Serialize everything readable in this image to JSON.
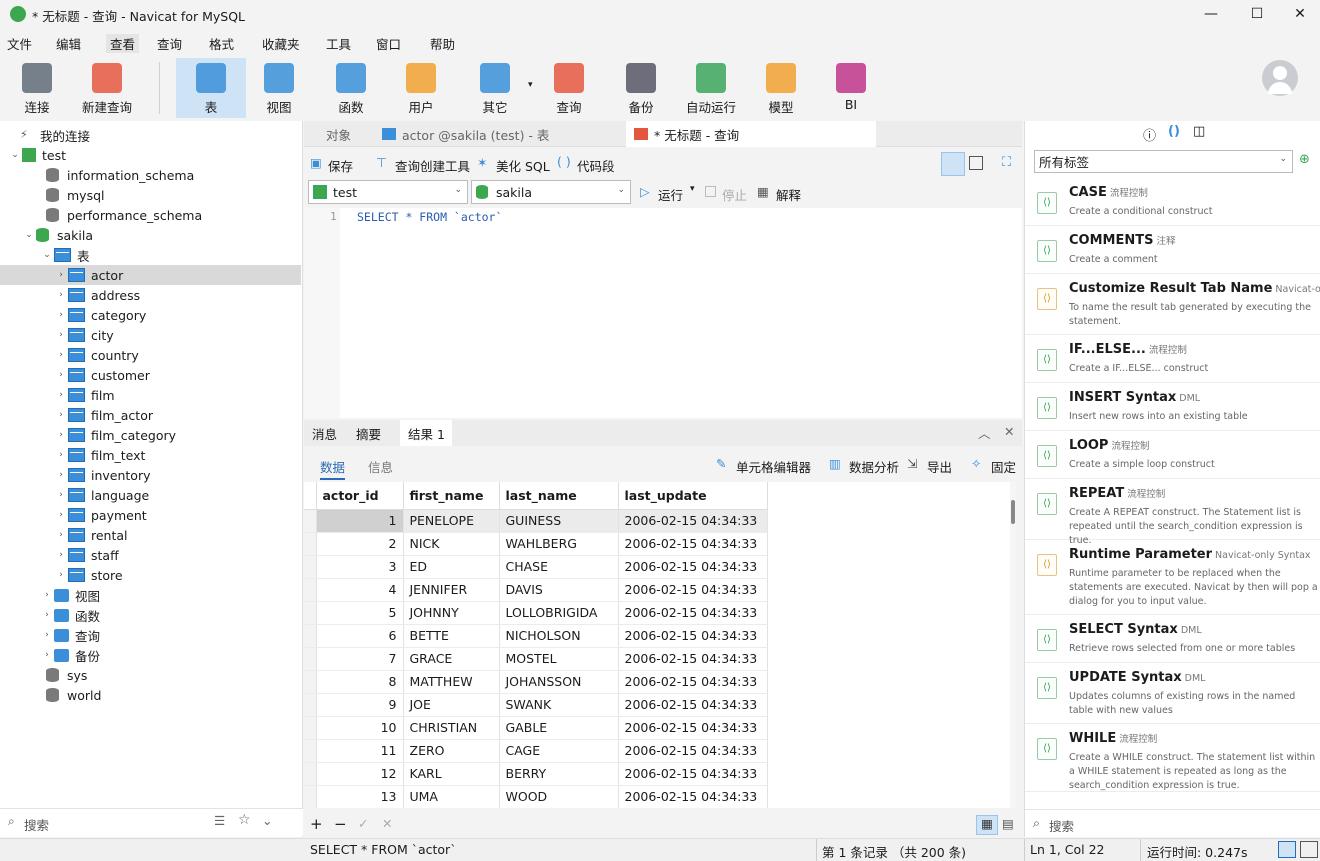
{
  "window": {
    "title": "* 无标题 - 查询 - Navicat for MySQL",
    "min": "—",
    "max": "☐",
    "close": "✕"
  },
  "menu": [
    "文件",
    "编辑",
    "查看",
    "查询",
    "格式",
    "收藏夹",
    "工具",
    "窗口",
    "帮助"
  ],
  "ribbon": [
    {
      "label": "连接",
      "icon": "plug-icon",
      "color": "#5e6b78"
    },
    {
      "label": "新建查询",
      "icon": "new-query-icon",
      "color": "#e4573f"
    },
    {
      "label": "表",
      "icon": "table-icon",
      "color": "#3a8fd8",
      "active": true
    },
    {
      "label": "视图",
      "icon": "view-icon",
      "color": "#3a8fd8"
    },
    {
      "label": "函数",
      "icon": "function-icon",
      "color": "#3a8fd8"
    },
    {
      "label": "用户",
      "icon": "user-icon",
      "color": "#f0a030"
    },
    {
      "label": "其它",
      "icon": "tools-icon",
      "color": "#3a8fd8"
    },
    {
      "label": "查询",
      "icon": "query-icon",
      "color": "#e4573f"
    },
    {
      "label": "备份",
      "icon": "backup-icon",
      "color": "#556"
    },
    {
      "label": "自动运行",
      "icon": "robot-icon",
      "color": "#3aa55a"
    },
    {
      "label": "模型",
      "icon": "model-icon",
      "color": "#f0a030"
    },
    {
      "label": "BI",
      "icon": "bi-icon",
      "color": "#c0358a"
    }
  ],
  "tree": {
    "root": "我的连接",
    "conn": "test",
    "dbs_before": [
      "information_schema",
      "mysql",
      "performance_schema"
    ],
    "db": "sakila",
    "tables_folder": "表",
    "tables": [
      "actor",
      "address",
      "category",
      "city",
      "country",
      "customer",
      "film",
      "film_actor",
      "film_category",
      "film_text",
      "inventory",
      "language",
      "payment",
      "rental",
      "staff",
      "store"
    ],
    "folders": [
      "视图",
      "函数",
      "查询",
      "备份"
    ],
    "dbs_after": [
      "sys",
      "world"
    ],
    "search": "搜索"
  },
  "tabs": [
    "对象",
    "actor @sakila (test) - 表",
    "* 无标题 - 查询"
  ],
  "query_toolbar": {
    "save": "保存",
    "builder": "查询创建工具",
    "beautify": "美化 SQL",
    "snippet": "代码段"
  },
  "query_toolbar2": {
    "conn": "test",
    "db": "sakila",
    "run": "运行",
    "stop": "停止",
    "explain": "解释"
  },
  "editor": {
    "line": "1",
    "sql": "SELECT * FROM `actor`"
  },
  "result_tabs": [
    "消息",
    "摘要",
    "结果 1"
  ],
  "result_sub": {
    "data": "数据",
    "info": "信息",
    "cell_editor": "单元格编辑器",
    "analysis": "数据分析",
    "export": "导出",
    "pin": "固定"
  },
  "grid": {
    "columns": [
      "actor_id",
      "first_name",
      "last_name",
      "last_update"
    ],
    "rows": [
      [
        "1",
        "PENELOPE",
        "GUINESS",
        "2006-02-15 04:34:33"
      ],
      [
        "2",
        "NICK",
        "WAHLBERG",
        "2006-02-15 04:34:33"
      ],
      [
        "3",
        "ED",
        "CHASE",
        "2006-02-15 04:34:33"
      ],
      [
        "4",
        "JENNIFER",
        "DAVIS",
        "2006-02-15 04:34:33"
      ],
      [
        "5",
        "JOHNNY",
        "LOLLOBRIGIDA",
        "2006-02-15 04:34:33"
      ],
      [
        "6",
        "BETTE",
        "NICHOLSON",
        "2006-02-15 04:34:33"
      ],
      [
        "7",
        "GRACE",
        "MOSTEL",
        "2006-02-15 04:34:33"
      ],
      [
        "8",
        "MATTHEW",
        "JOHANSSON",
        "2006-02-15 04:34:33"
      ],
      [
        "9",
        "JOE",
        "SWANK",
        "2006-02-15 04:34:33"
      ],
      [
        "10",
        "CHRISTIAN",
        "GABLE",
        "2006-02-15 04:34:33"
      ],
      [
        "11",
        "ZERO",
        "CAGE",
        "2006-02-15 04:34:33"
      ],
      [
        "12",
        "KARL",
        "BERRY",
        "2006-02-15 04:34:33"
      ],
      [
        "13",
        "UMA",
        "WOOD",
        "2006-02-15 04:34:33"
      ]
    ]
  },
  "status": {
    "sql": "SELECT * FROM `actor`",
    "records": "第 1 条记录 （共 200 条)",
    "pos": "Ln 1, Col 22",
    "time": "运行时间: 0.247s"
  },
  "snippets": {
    "tag": "所有标签",
    "search": "搜索",
    "items": [
      {
        "title": "CASE",
        "tag": "流程控制",
        "desc": "Create a conditional construct",
        "y": false
      },
      {
        "title": "COMMENTS",
        "tag": "注释",
        "desc": "Create a comment",
        "y": false
      },
      {
        "title": "Customize Result Tab Name",
        "tag": "Navicat-only",
        "desc": "To name the result tab generated by executing the statement.",
        "y": true
      },
      {
        "title": "IF...ELSE...",
        "tag": "流程控制",
        "desc": "Create a IF...ELSE... construct",
        "y": false
      },
      {
        "title": "INSERT Syntax",
        "tag": "DML",
        "desc": "Insert new rows into an existing table",
        "y": false
      },
      {
        "title": "LOOP",
        "tag": "流程控制",
        "desc": "Create a simple loop construct",
        "y": false
      },
      {
        "title": "REPEAT",
        "tag": "流程控制",
        "desc": "Create A REPEAT construct. The Statement list is repeated until the search_condition expression is true.",
        "y": false
      },
      {
        "title": "Runtime Parameter",
        "tag": "Navicat-only Syntax",
        "desc": "Runtime parameter to be replaced when the statements are executed. Navicat by then will pop a dialog for you to input value.",
        "y": true
      },
      {
        "title": "SELECT Syntax",
        "tag": "DML",
        "desc": "Retrieve rows selected from one or more tables",
        "y": false
      },
      {
        "title": "UPDATE Syntax",
        "tag": "DML",
        "desc": "Updates columns of existing rows in the named table with new values",
        "y": false
      },
      {
        "title": "WHILE",
        "tag": "流程控制",
        "desc": "Create a WHILE construct. The statement list within a WHILE statement is repeated as long as the search_condition expression is true.",
        "y": false
      }
    ]
  }
}
